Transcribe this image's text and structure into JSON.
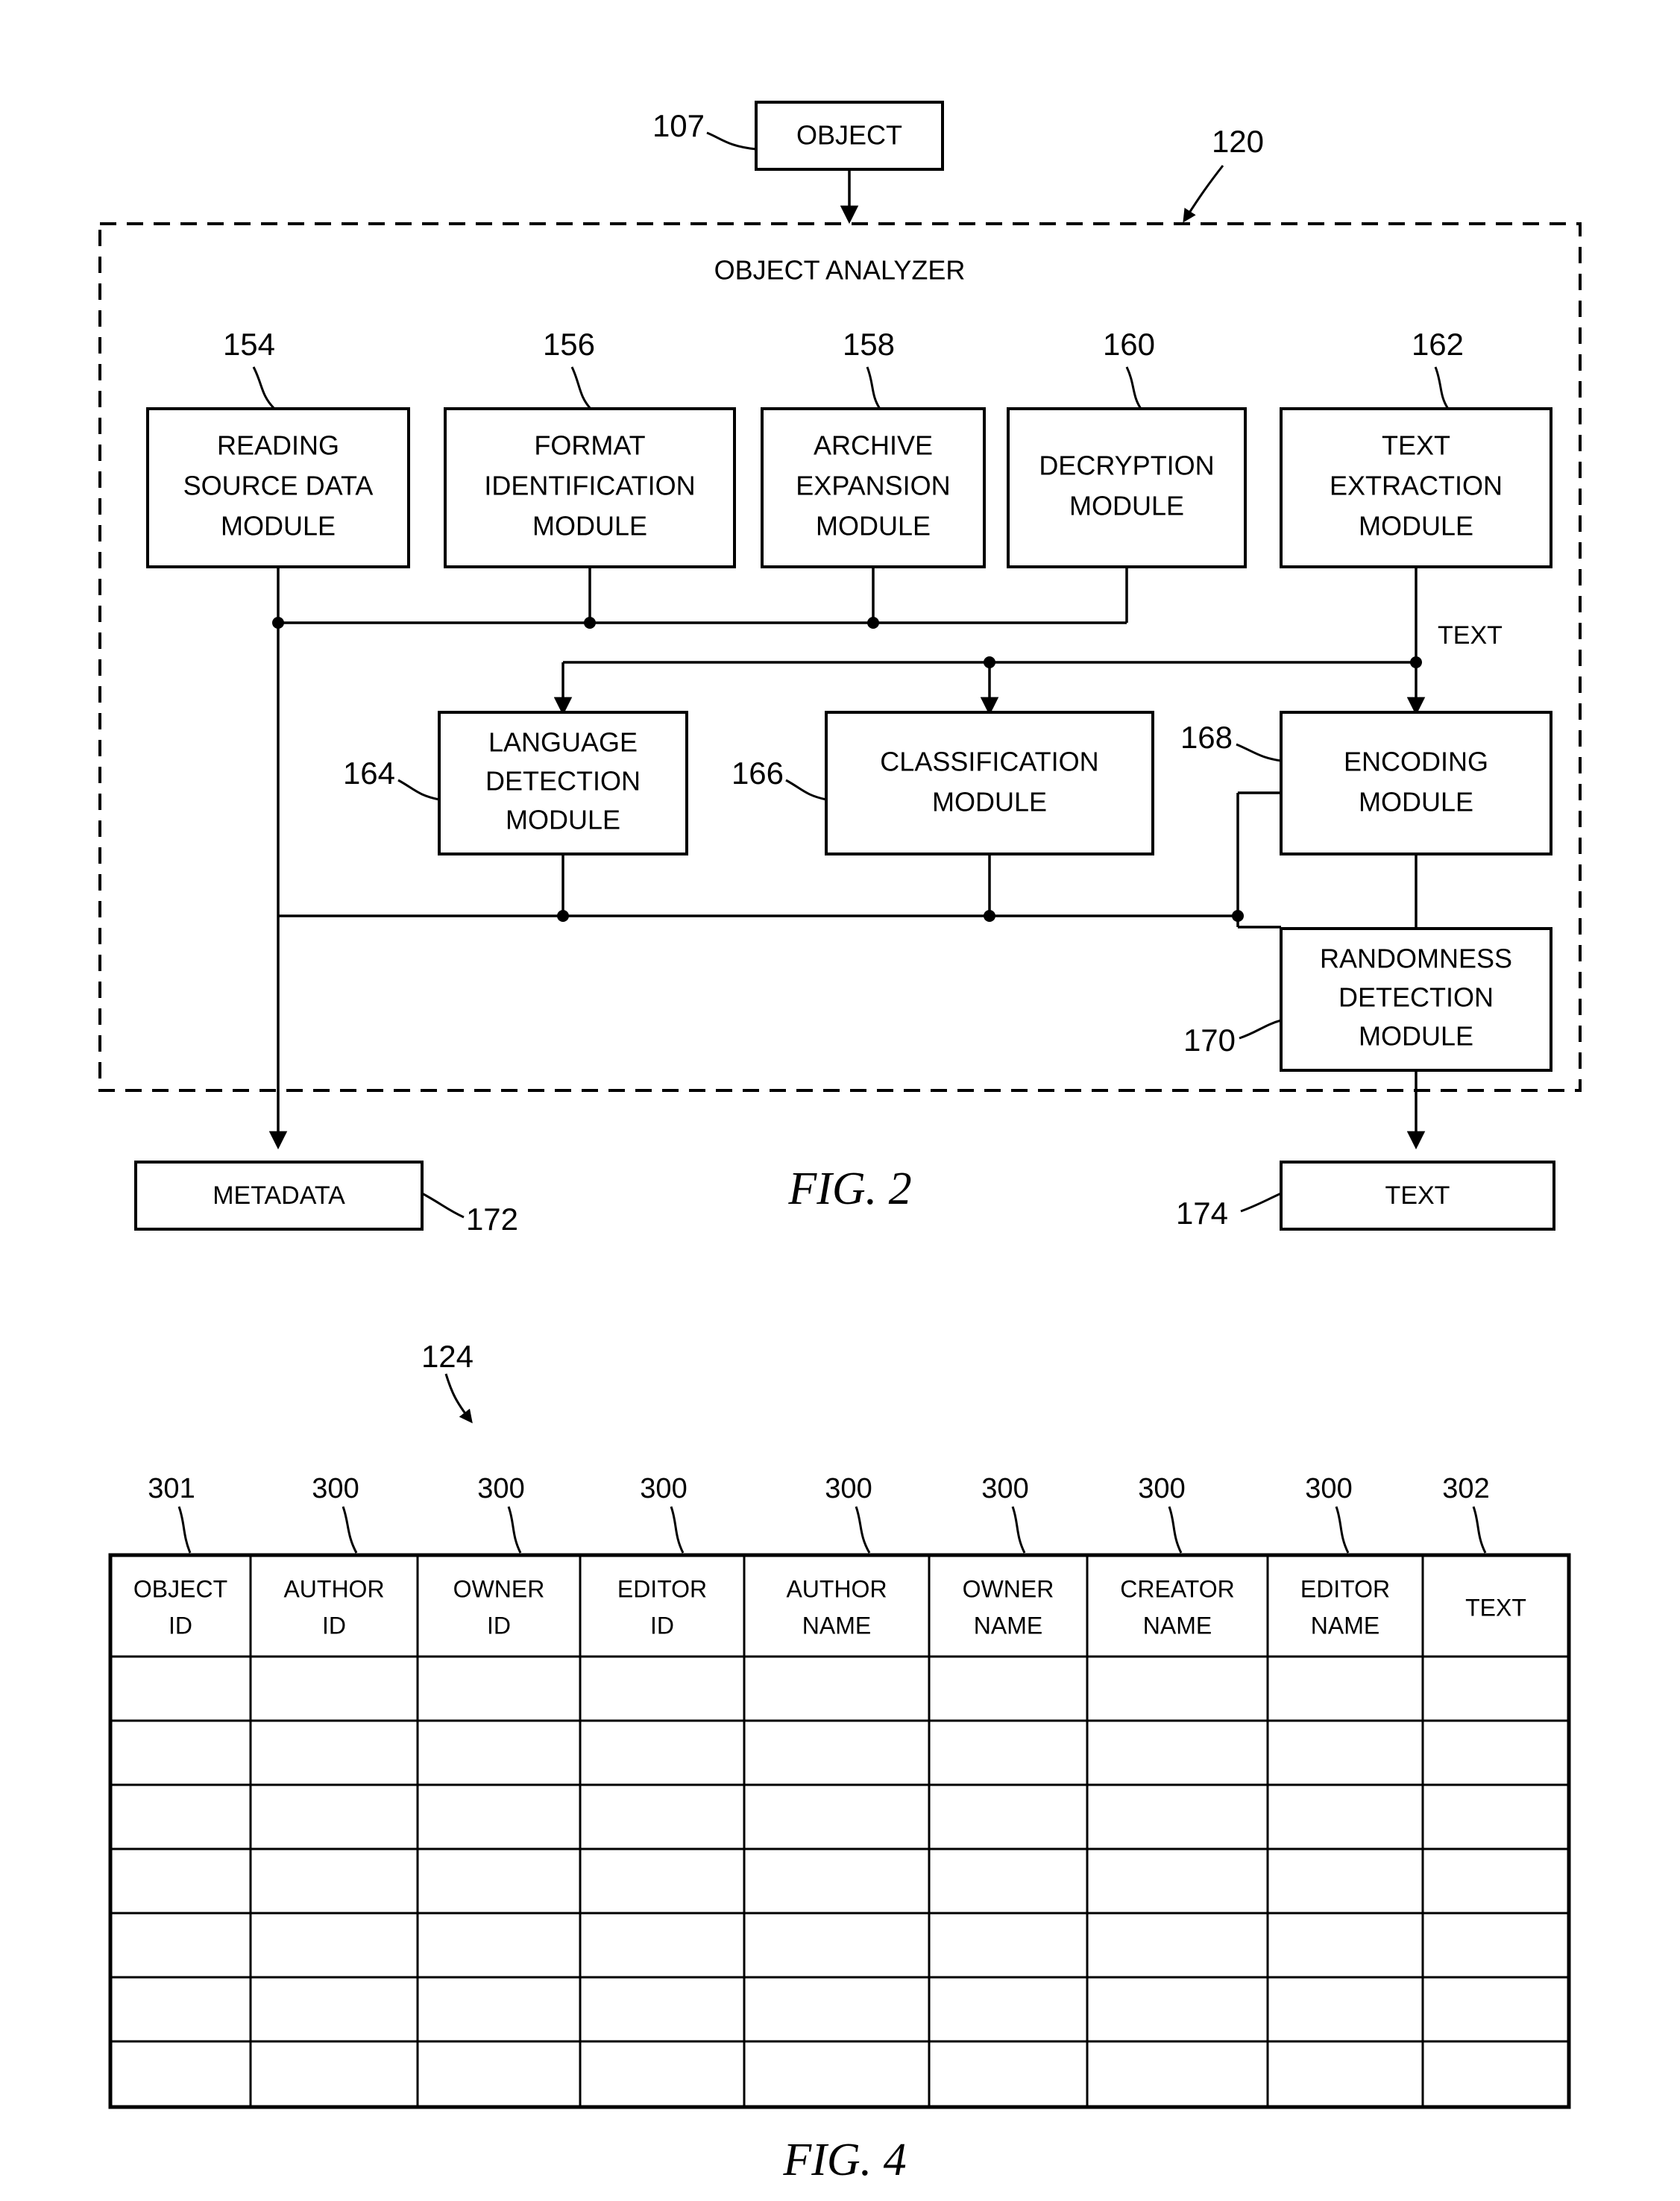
{
  "figure2": {
    "caption": "FIG. 2",
    "object_box": {
      "label": "OBJECT",
      "ref": "107"
    },
    "container": {
      "title": "OBJECT ANALYZER",
      "ref": "120"
    },
    "top_modules": [
      {
        "ref": "154",
        "lines": [
          "READING",
          "SOURCE DATA",
          "MODULE"
        ]
      },
      {
        "ref": "156",
        "lines": [
          "FORMAT",
          "IDENTIFICATION",
          "MODULE"
        ]
      },
      {
        "ref": "158",
        "lines": [
          "ARCHIVE",
          "EXPANSION",
          "MODULE"
        ]
      },
      {
        "ref": "160",
        "lines": [
          "DECRYPTION",
          "MODULE"
        ]
      },
      {
        "ref": "162",
        "lines": [
          "TEXT",
          "EXTRACTION",
          "MODULE"
        ]
      }
    ],
    "mid_modules": [
      {
        "ref": "164",
        "lines": [
          "LANGUAGE",
          "DETECTION",
          "MODULE"
        ]
      },
      {
        "ref": "166",
        "lines": [
          "CLASSIFICATION",
          "MODULE"
        ]
      },
      {
        "ref": "168",
        "lines": [
          "ENCODING",
          "MODULE"
        ]
      },
      {
        "ref": "170",
        "lines": [
          "RANDOMNESS",
          "DETECTION",
          "MODULE"
        ]
      }
    ],
    "edge_labels": {
      "text_signal": "TEXT"
    },
    "outputs": [
      {
        "ref": "172",
        "label": "METADATA"
      },
      {
        "ref": "174",
        "label": "TEXT"
      }
    ]
  },
  "figure4": {
    "caption": "FIG. 4",
    "table_ref": "124",
    "column_refs": [
      "301",
      "300",
      "300",
      "300",
      "300",
      "300",
      "300",
      "300",
      "302"
    ],
    "columns": [
      {
        "lines": [
          "OBJECT",
          "ID"
        ]
      },
      {
        "lines": [
          "AUTHOR",
          "ID"
        ]
      },
      {
        "lines": [
          "OWNER",
          "ID"
        ]
      },
      {
        "lines": [
          "EDITOR",
          "ID"
        ]
      },
      {
        "lines": [
          "AUTHOR",
          "NAME"
        ]
      },
      {
        "lines": [
          "OWNER",
          "NAME"
        ]
      },
      {
        "lines": [
          "CREATOR",
          "NAME"
        ]
      },
      {
        "lines": [
          "EDITOR",
          "NAME"
        ]
      },
      {
        "lines": [
          "TEXT"
        ]
      }
    ],
    "body_row_count": 7,
    "body_rows": [
      [
        "",
        "",
        "",
        "",
        "",
        "",
        "",
        "",
        ""
      ],
      [
        "",
        "",
        "",
        "",
        "",
        "",
        "",
        "",
        ""
      ],
      [
        "",
        "",
        "",
        "",
        "",
        "",
        "",
        "",
        ""
      ],
      [
        "",
        "",
        "",
        "",
        "",
        "",
        "",
        "",
        ""
      ],
      [
        "",
        "",
        "",
        "",
        "",
        "",
        "",
        "",
        ""
      ],
      [
        "",
        "",
        "",
        "",
        "",
        "",
        "",
        "",
        ""
      ],
      [
        "",
        "",
        "",
        "",
        "",
        "",
        "",
        "",
        ""
      ]
    ]
  },
  "colors": {
    "ink": "#000000",
    "paper": "#ffffff"
  }
}
